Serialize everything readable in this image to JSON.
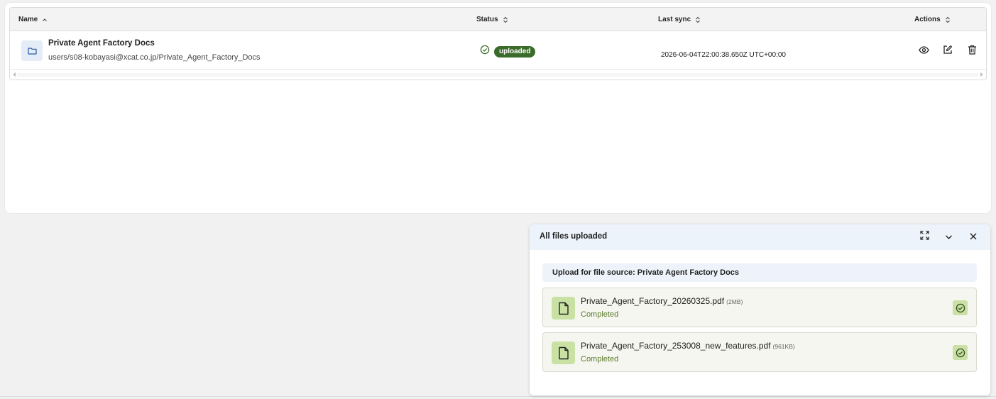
{
  "table": {
    "columns": {
      "name": "Name",
      "status": "Status",
      "last_sync": "Last sync",
      "actions": "Actions"
    },
    "rows": [
      {
        "title": "Private Agent Factory Docs",
        "path": "users/s08-kobayasi@xcat.co.jp/Private_Agent_Factory_Docs",
        "status": "uploaded",
        "last_sync": "2026-06-04T22:00:38.650Z UTC+00:00"
      }
    ]
  },
  "upload_panel": {
    "title": "All files uploaded",
    "source_label": "Upload for file source: Private Agent Factory Docs",
    "files": [
      {
        "name": "Private_Agent_Factory_20260325.pdf",
        "size": "(2MB)",
        "status": "Completed"
      },
      {
        "name": "Private_Agent_Factory_253008_new_features.pdf",
        "size": "(961KB)",
        "status": "Completed"
      }
    ]
  },
  "colors": {
    "badge_green": "#3b6b2a",
    "file_tile_green": "#c9e2a4",
    "panel_header_blue": "#edf3fb",
    "folder_tile_blue": "#e4ecf7"
  }
}
